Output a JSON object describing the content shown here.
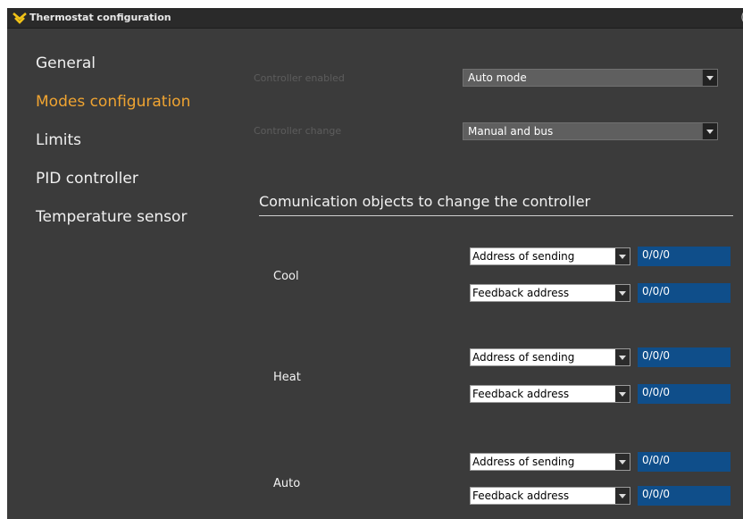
{
  "window": {
    "title": "Thermostat configuration",
    "icon": "yellow-chevrons-icon"
  },
  "nav": {
    "items": [
      {
        "label": "General"
      },
      {
        "label": "Modes configuration",
        "active": true
      },
      {
        "label": "Limits"
      },
      {
        "label": "PID controller"
      },
      {
        "label": "Temperature sensor"
      }
    ]
  },
  "settings": {
    "controller_enabled": {
      "label": "Controller enabled",
      "value": "Auto mode"
    },
    "controller_change": {
      "label": "Controller change",
      "value": "Manual and bus"
    }
  },
  "section": {
    "title": "Comunication objects to change the controller"
  },
  "modes": [
    {
      "label": "Cool",
      "send_select": "Address of sending",
      "send_address": "0/0/0",
      "feedback_select": "Feedback address",
      "feedback_address": "0/0/0"
    },
    {
      "label": "Heat",
      "send_select": "Address of sending",
      "send_address": "0/0/0",
      "feedback_select": "Feedback address",
      "feedback_address": "0/0/0"
    },
    {
      "label": "Auto",
      "send_select": "Address of sending",
      "send_address": "0/0/0",
      "feedback_select": "Feedback address",
      "feedback_address": "0/0/0"
    }
  ],
  "colors": {
    "background": "#3b3b3b",
    "active_nav": "#f0a431",
    "address_field": "#0f4e8a"
  }
}
